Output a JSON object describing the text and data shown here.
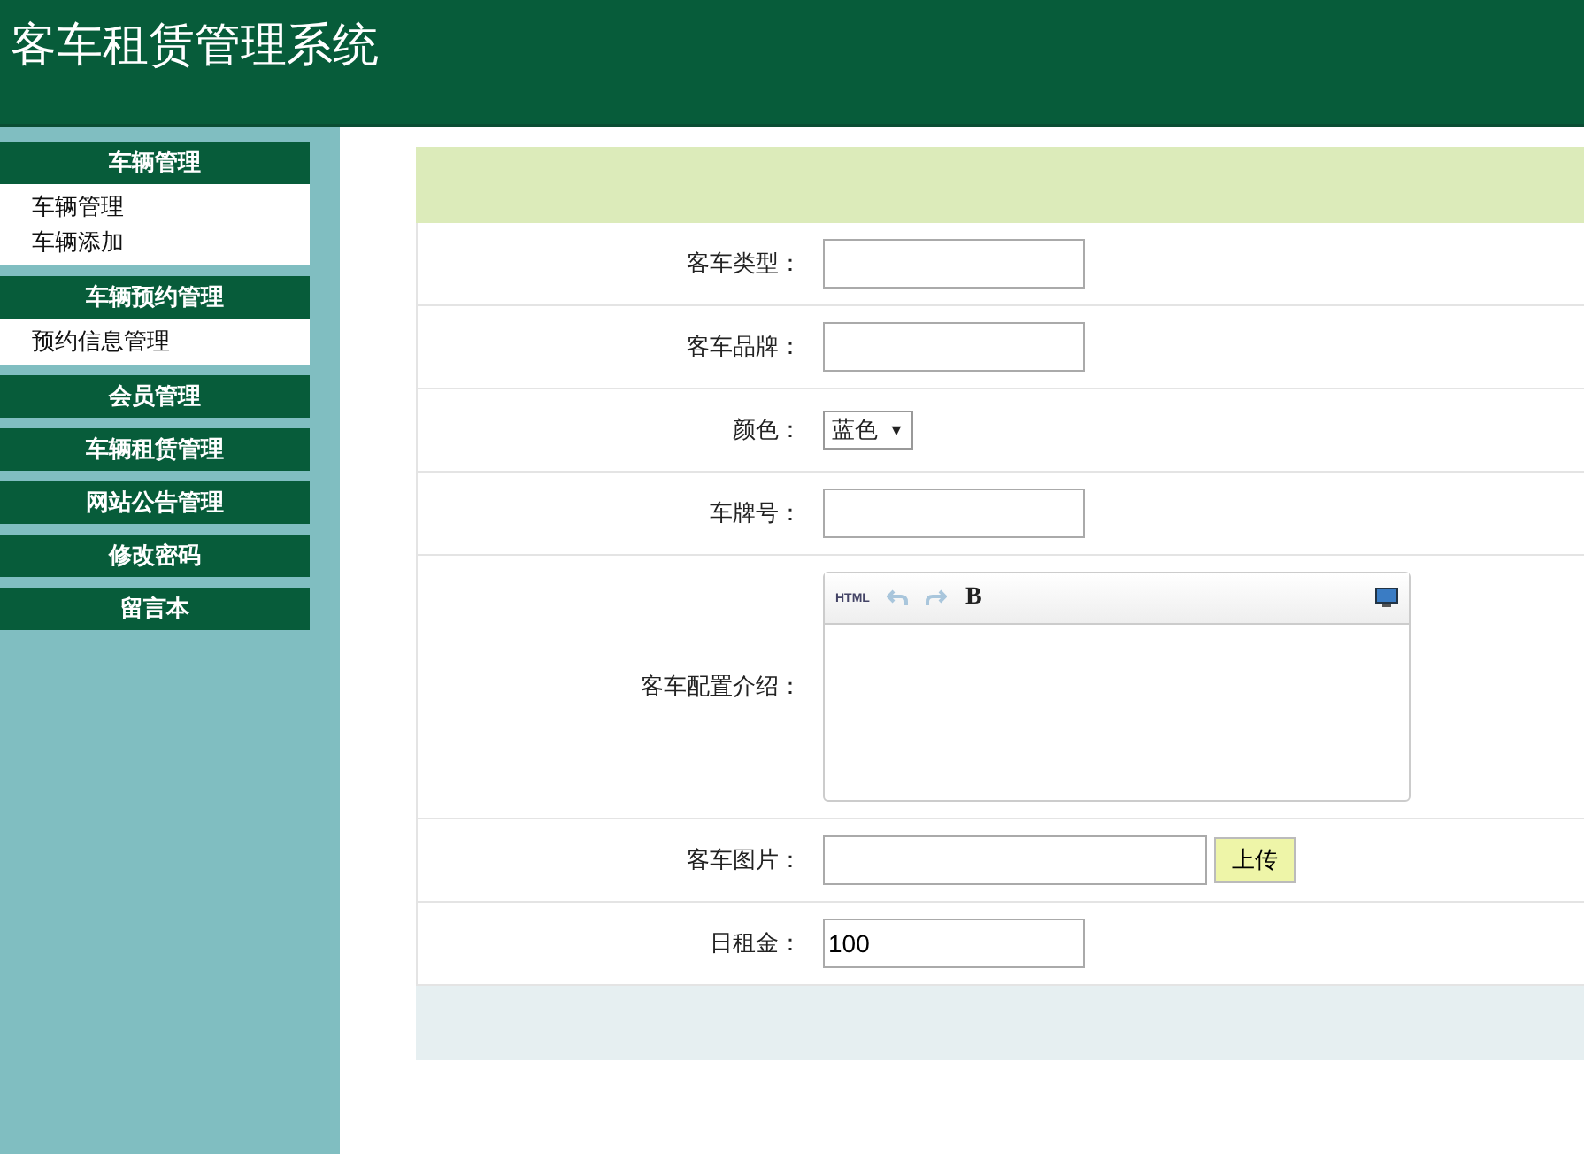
{
  "header": {
    "title": "客车租赁管理系统"
  },
  "sidebar": {
    "sections": [
      {
        "title": "车辆管理",
        "items": [
          "车辆管理",
          "车辆添加"
        ]
      },
      {
        "title": "车辆预约管理",
        "items": [
          "预约信息管理"
        ]
      },
      {
        "title": "会员管理"
      },
      {
        "title": "车辆租赁管理"
      },
      {
        "title": "网站公告管理"
      },
      {
        "title": "修改密码"
      },
      {
        "title": "留言本"
      }
    ]
  },
  "form": {
    "fields": [
      {
        "kind": "text",
        "label": "客车类型："
      },
      {
        "kind": "text",
        "label": "客车品牌："
      },
      {
        "kind": "select",
        "label": "颜色：",
        "value": "蓝色",
        "caret": "▼"
      },
      {
        "kind": "text",
        "label": "车牌号："
      },
      {
        "kind": "editor",
        "label": "客车配置介绍：",
        "toolbar": [
          "HTML",
          "B"
        ]
      },
      {
        "kind": "file",
        "label": "客车图片：",
        "button": "上传"
      },
      {
        "kind": "text",
        "label": "日租金：",
        "value": "100"
      }
    ]
  }
}
